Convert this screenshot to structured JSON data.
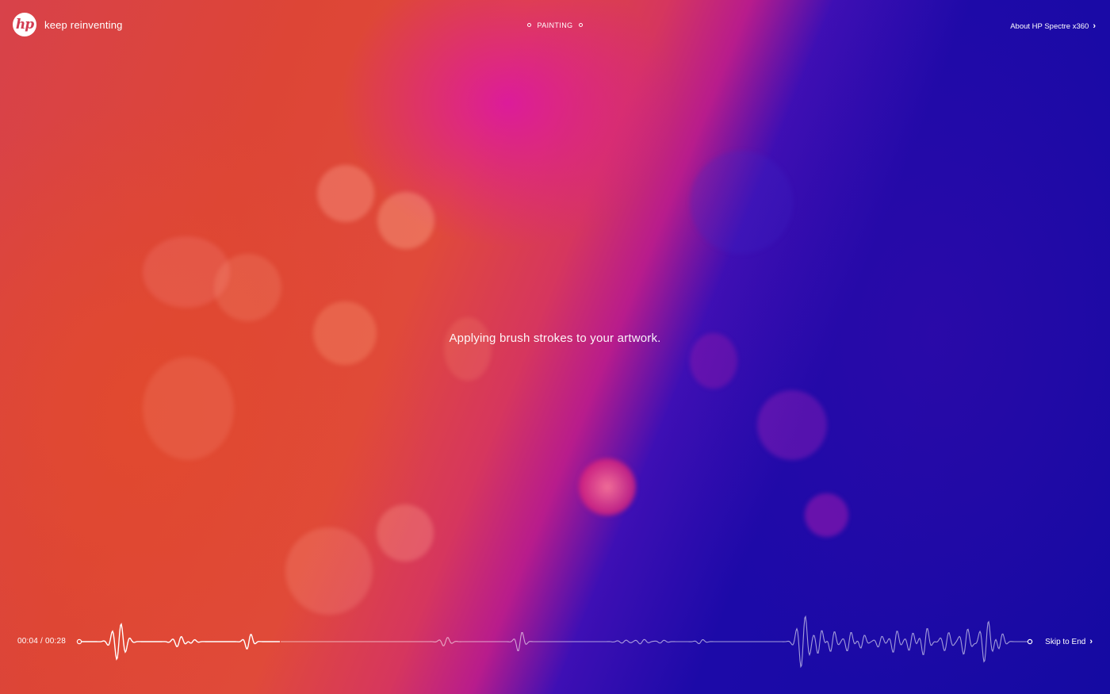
{
  "header": {
    "logo_text": "hp",
    "tagline": "keep reinventing",
    "section_label": "PAINTING",
    "about_link": "About HP Spectre x360"
  },
  "main": {
    "status_text": "Applying brush strokes to your artwork."
  },
  "player": {
    "current_time": "00:04",
    "separator": "/",
    "total_time": "00:28",
    "progress": 0.143,
    "skip_label": "Skip to End"
  },
  "icons": {
    "about_chevron": "chevron-right-icon",
    "skip_chevron": "chevron-right-icon"
  },
  "colors": {
    "warm": "#e04a3a",
    "magenta": "#c8208c",
    "deep_blue": "#1a0aa8",
    "text": "#ffffff"
  }
}
